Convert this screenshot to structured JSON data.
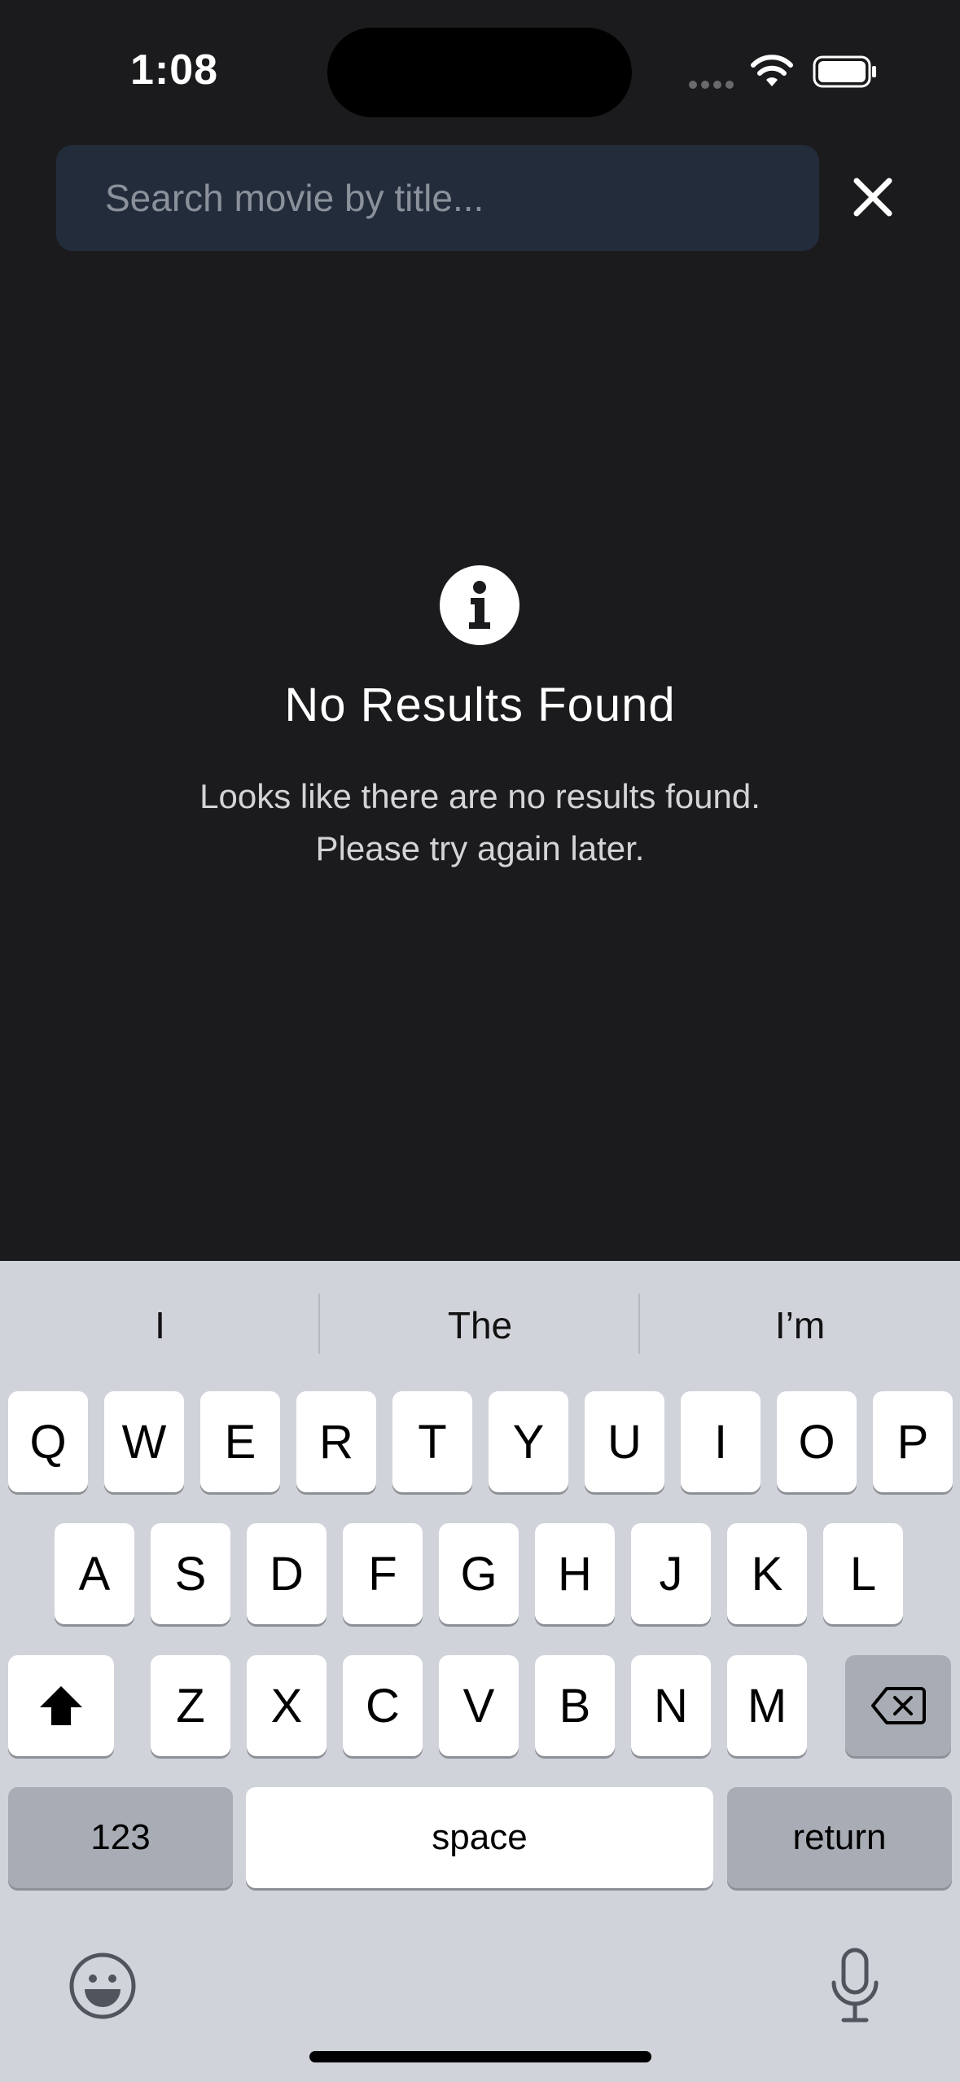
{
  "status_bar": {
    "time": "1:08"
  },
  "search": {
    "placeholder": "Search movie by title...",
    "close_icon": "close-icon"
  },
  "empty_state": {
    "icon": "info-icon",
    "title": "No Results Found",
    "message": "Looks like there are no results found. Please try again later."
  },
  "keyboard": {
    "suggestions": [
      "I",
      "The",
      "I’m"
    ],
    "row1": [
      "Q",
      "W",
      "E",
      "R",
      "T",
      "Y",
      "U",
      "I",
      "O",
      "P"
    ],
    "row2": [
      "A",
      "S",
      "D",
      "F",
      "G",
      "H",
      "J",
      "K",
      "L"
    ],
    "row3": [
      "Z",
      "X",
      "C",
      "V",
      "B",
      "N",
      "M"
    ],
    "numbers_label": "123",
    "space_label": "space",
    "return_label": "return"
  },
  "colors": {
    "background": "#1b1b1e",
    "search_field": "#222c3b",
    "keyboard": "#d0d3da"
  }
}
